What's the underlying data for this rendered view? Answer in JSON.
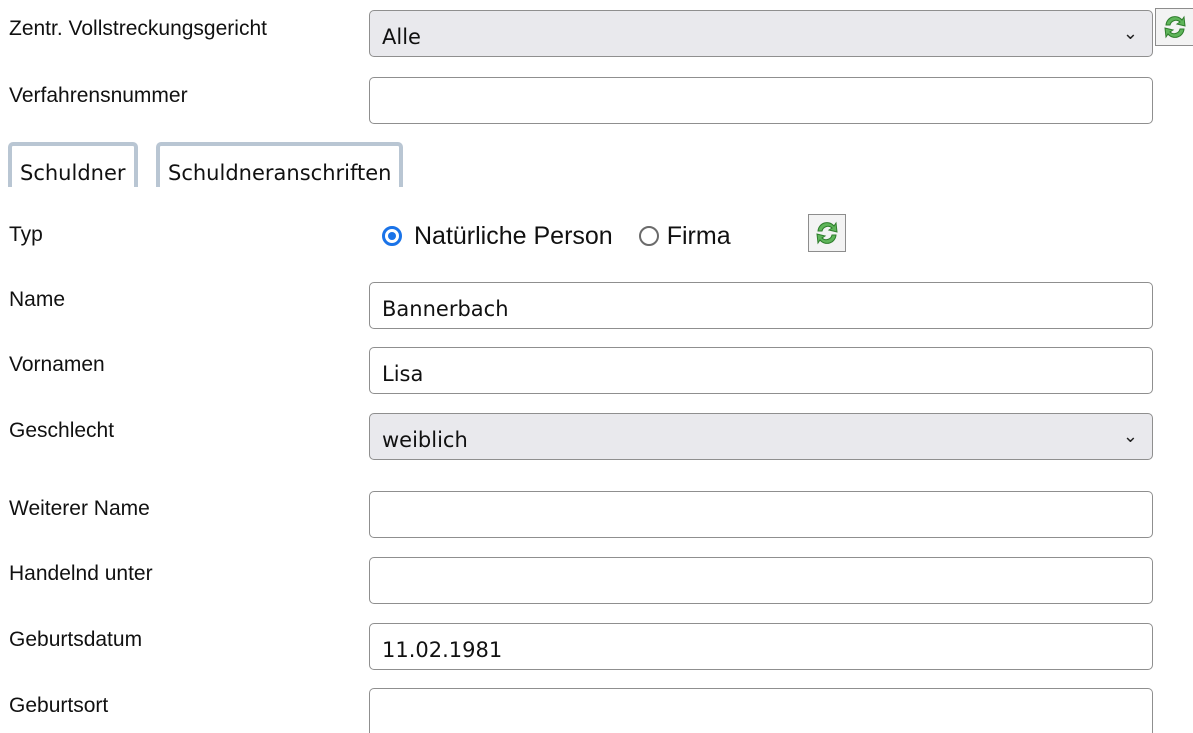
{
  "court": {
    "label": "Zentr. Vollstreckungsgericht",
    "value": "Alle",
    "refresh_icon": "refresh-icon"
  },
  "case_number": {
    "label": "Verfahrensnummer",
    "value": ""
  },
  "tabs": [
    {
      "label": "Schuldner",
      "active": true
    },
    {
      "label": "Schuldneranschriften",
      "active": false
    }
  ],
  "type": {
    "label": "Typ",
    "options": [
      {
        "label": "Natürliche Person",
        "selected": true
      },
      {
        "label": "Firma",
        "selected": false
      }
    ],
    "refresh_icon": "refresh-icon"
  },
  "name": {
    "label": "Name",
    "value": "Bannerbach"
  },
  "first_names": {
    "label": "Vornamen",
    "value": "Lisa"
  },
  "gender": {
    "label": "Geschlecht",
    "value": "weiblich"
  },
  "other_name": {
    "label": "Weiterer Name",
    "value": ""
  },
  "trading_as": {
    "label": "Handelnd unter",
    "value": ""
  },
  "birth_date": {
    "label": "Geburtsdatum",
    "value": "11.02.1981"
  },
  "birth_place": {
    "label": "Geburtsort",
    "value": ""
  },
  "colors": {
    "accent": "#1a73e8",
    "tab_border": "#b9c6d3",
    "select_bg": "#e9e9ed"
  }
}
